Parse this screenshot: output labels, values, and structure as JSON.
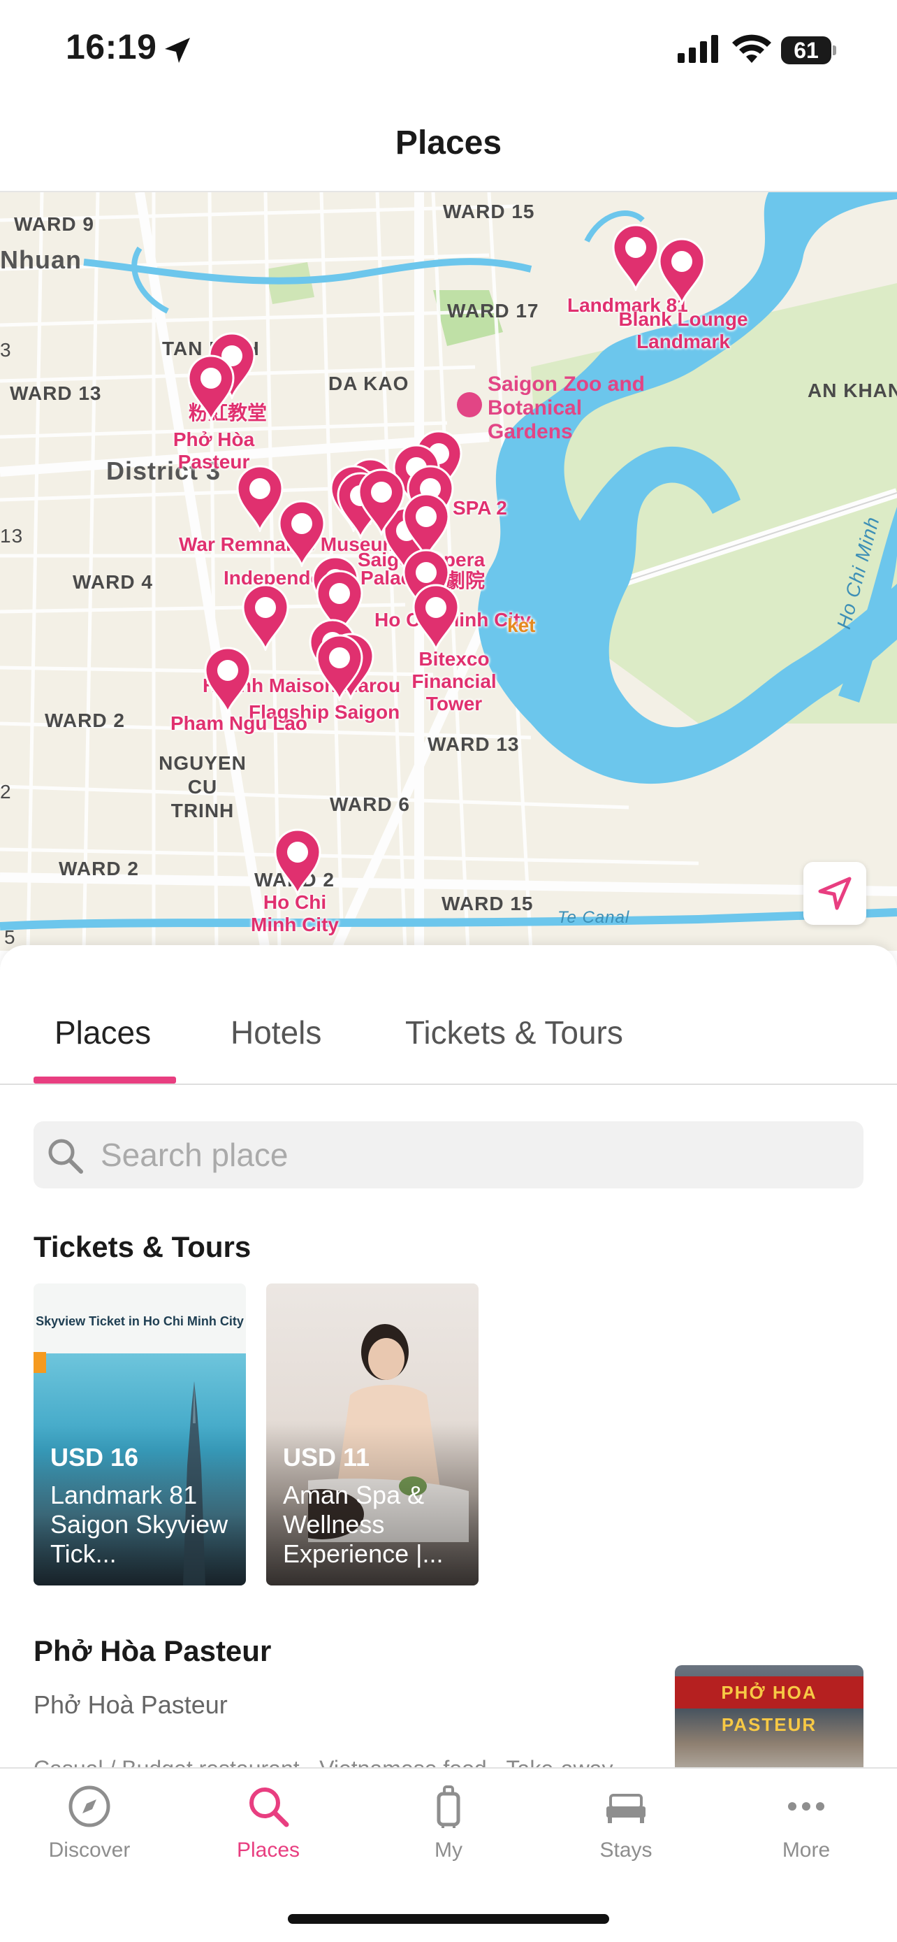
{
  "status_bar": {
    "time": "16:19",
    "battery": "61",
    "icons": [
      "location-arrow-icon",
      "signal-icon",
      "wifi-icon",
      "battery-icon"
    ]
  },
  "nav": {
    "title": "Places"
  },
  "map": {
    "area_labels": [
      "WARD 9",
      "Nhuan",
      "WARD 13",
      "TAN BINH",
      "DA KAO",
      "WARD 17",
      "WARD 15",
      "AN KHANH",
      "District 3",
      "WARD 4",
      "WARD 2",
      "NGUYEN CU TRINH",
      "WARD 6",
      "WARD 13",
      "WARD 2",
      "WARD 2",
      "WARD 15",
      "Ho Chi Minh",
      "Te Canal",
      "3",
      "13",
      "2",
      "5"
    ],
    "green_label": "Saigon Zoo and Botanical Gardens",
    "poi_labels": [
      "Landmark 81",
      "Blank Lounge Landmark",
      "粉紅教堂",
      "Phở Hòa Pasteur",
      "SPA 2",
      "War Remnants Museum",
      "Independence Palace",
      "Saigon Opera",
      "Ho Chi Minh City",
      "Bitexco Financial Tower",
      "Huỳnh Maison Marou",
      "Flagship Saigon",
      "Pham Ngu Lao",
      "Ho Chi Minh City",
      "歌劇院",
      "ket"
    ],
    "accent_color": "#e0306f",
    "locate_button_icon": "navigation-arrow-icon"
  },
  "tabs": [
    "Places",
    "Hotels",
    "Tickets & Tours"
  ],
  "active_tab": "Places",
  "search": {
    "placeholder": "Search place",
    "icon": "search-icon"
  },
  "tickets_section": {
    "title": "Tickets & Tours",
    "cards": [
      {
        "banner": "Skyview Ticket in Ho Chi Minh City",
        "price": "USD 16",
        "title": "Landmark 81 Saigon Skyview Tick..."
      },
      {
        "banner": "",
        "price": "USD 11",
        "title": "Aman Spa & Wellness Experience |..."
      }
    ]
  },
  "place": {
    "name": "Phở Hòa Pasteur",
    "subtitle": "Phở Hoà Pasteur",
    "thumb_sign": "PHỞ HOA PASTEUR",
    "description": "Casual / Budget restaurant · Vietnamese food · Take-away"
  },
  "tab_bar": [
    {
      "label": "Discover",
      "icon": "compass-icon",
      "active": false
    },
    {
      "label": "Places",
      "icon": "search-icon",
      "active": true
    },
    {
      "label": "My",
      "icon": "luggage-icon",
      "active": false
    },
    {
      "label": "Stays",
      "icon": "bed-icon",
      "active": false
    },
    {
      "label": "More",
      "icon": "more-dots-icon",
      "active": false
    }
  ],
  "colors": {
    "accent": "#e83e80",
    "map_water": "#6cc6ec",
    "map_park": "#d7ebc2"
  }
}
